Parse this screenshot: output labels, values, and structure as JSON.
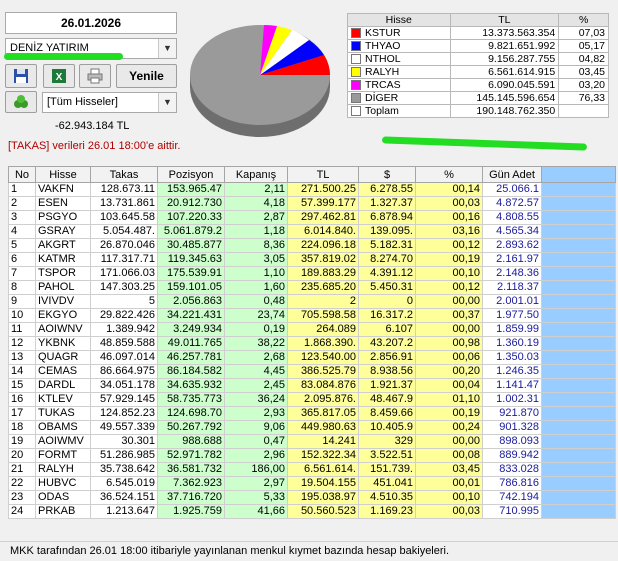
{
  "date": "26.01.2026",
  "broker_select": {
    "value": "DENİZ YATIRIM"
  },
  "toolbar": {
    "refresh_label": "Yenile"
  },
  "stock_filter": {
    "value": "[Tüm Hisseler]"
  },
  "takas_total": "-62.943.184 TL",
  "takas_note": "[TAKAS] verileri 26.01 18:00'e aittir.",
  "summary": {
    "headers": [
      "Hisse",
      "TL",
      "%"
    ],
    "rows": [
      {
        "hisse": "KSTUR",
        "tl": "13.373.563.354",
        "pct": "07,03",
        "color": "#ff0000"
      },
      {
        "hisse": "THYAO",
        "tl": "9.821.651.992",
        "pct": "05,17",
        "color": "#0000ff"
      },
      {
        "hisse": "NTHOL",
        "tl": "9.156.287.755",
        "pct": "04,82",
        "color": "#ffffff"
      },
      {
        "hisse": "RALYH",
        "tl": "6.561.614.915",
        "pct": "03,45",
        "color": "#ffff00"
      },
      {
        "hisse": "TRCAS",
        "tl": "6.090.045.591",
        "pct": "03,20",
        "color": "#ff00ff"
      },
      {
        "hisse": "DİGER",
        "tl": "145.145.596.654",
        "pct": "76,33",
        "color": "#999999"
      }
    ],
    "total": {
      "label": "Toplam",
      "tl": "190.148.762.350"
    }
  },
  "table": {
    "headers": [
      "No",
      "Hisse",
      "Takas",
      "Pozisyon",
      "Kapanış",
      "TL",
      "$",
      "%",
      "Gün Adet"
    ],
    "rows": [
      [
        "1",
        "VAKFN",
        "128.673.11",
        "153.965.47",
        "2,11",
        "271.500.25",
        "6.278.55",
        "00,14",
        "25.066.1"
      ],
      [
        "2",
        "ESEN",
        "13.731.861",
        "20.912.730",
        "4,18",
        "57.399.177",
        "1.327.37",
        "00,03",
        "4.872.57"
      ],
      [
        "3",
        "PSGYO",
        "103.645.58",
        "107.220.33",
        "2,87",
        "297.462.81",
        "6.878.94",
        "00,16",
        "4.808.55"
      ],
      [
        "4",
        "GSRAY",
        "5.054.487.",
        "5.061.879.2",
        "1,18",
        "6.014.840.",
        "139.095.",
        "03,16",
        "4.565.34"
      ],
      [
        "5",
        "AKGRT",
        "26.870.046",
        "30.485.877",
        "8,36",
        "224.096.18",
        "5.182.31",
        "00,12",
        "2.893.62"
      ],
      [
        "6",
        "KATMR",
        "117.317.71",
        "119.345.63",
        "3,05",
        "357.819.02",
        "8.274.70",
        "00,19",
        "2.161.97"
      ],
      [
        "7",
        "TSPOR",
        "171.066.03",
        "175.539.91",
        "1,10",
        "189.883.29",
        "4.391.12",
        "00,10",
        "2.148.36"
      ],
      [
        "8",
        "PAHOL",
        "147.303.25",
        "159.101.05",
        "1,60",
        "235.685.20",
        "5.450.31",
        "00,12",
        "2.118.37"
      ],
      [
        "9",
        "IVIVDV",
        "5",
        "2.056.863",
        "0,48",
        "2",
        "0",
        "00,00",
        "2.001.01"
      ],
      [
        "10",
        "EKGYO",
        "29.822.426",
        "34.221.431",
        "23,74",
        "705.598.58",
        "16.317.2",
        "00,37",
        "1.977.50"
      ],
      [
        "11",
        "AOIWNV",
        "1.389.942",
        "3.249.934",
        "0,19",
        "264.089",
        "6.107",
        "00,00",
        "1.859.99"
      ],
      [
        "12",
        "YKBNK",
        "48.859.588",
        "49.011.765",
        "38,22",
        "1.868.390.",
        "43.207.2",
        "00,98",
        "1.360.19"
      ],
      [
        "13",
        "QUAGR",
        "46.097.014",
        "46.257.781",
        "2,68",
        "123.540.00",
        "2.856.91",
        "00,06",
        "1.350.03"
      ],
      [
        "14",
        "CEMAS",
        "86.664.975",
        "86.184.582",
        "4,45",
        "386.525.79",
        "8.938.56",
        "00,20",
        "1.246.35"
      ],
      [
        "15",
        "DARDL",
        "34.051.178",
        "34.635.932",
        "2,45",
        "83.084.876",
        "1.921.37",
        "00,04",
        "1.141.47"
      ],
      [
        "16",
        "KTLEV",
        "57.929.145",
        "58.735.773",
        "36,24",
        "2.095.876.",
        "48.467.9",
        "01,10",
        "1.002.31"
      ],
      [
        "17",
        "TUKAS",
        "124.852.23",
        "124.698.70",
        "2,93",
        "365.817.05",
        "8.459.66",
        "00,19",
        "921.870"
      ],
      [
        "18",
        "OBAMS",
        "49.557.339",
        "50.267.792",
        "9,06",
        "449.980.63",
        "10.405.9",
        "00,24",
        "901.328"
      ],
      [
        "19",
        "AOIWMV",
        "30.301",
        "988.688",
        "0,47",
        "14.241",
        "329",
        "00,00",
        "898.093"
      ],
      [
        "20",
        "FORMT",
        "51.286.985",
        "52.971.782",
        "2,96",
        "152.322.34",
        "3.522.51",
        "00,08",
        "889.942"
      ],
      [
        "21",
        "RALYH",
        "35.738.642",
        "36.581.732",
        "186,00",
        "6.561.614.",
        "151.739.",
        "03,45",
        "833.028"
      ],
      [
        "22",
        "HUBVC",
        "6.545.019",
        "7.362.923",
        "2,97",
        "19.504.155",
        "451.041",
        "00,01",
        "786.816"
      ],
      [
        "23",
        "ODAS",
        "36.524.151",
        "37.716.720",
        "5,33",
        "195.038.97",
        "4.510.35",
        "00,10",
        "742.194"
      ],
      [
        "24",
        "PRKAB",
        "1.213.647",
        "1.925.759",
        "41,66",
        "50.560.523",
        "1.169.23",
        "00,03",
        "710.995"
      ]
    ]
  },
  "footer": "MKK tarafından 26.01 18:00 itibariyle yayınlanan menkul kıymet bazında hesap bakiyeleri."
}
